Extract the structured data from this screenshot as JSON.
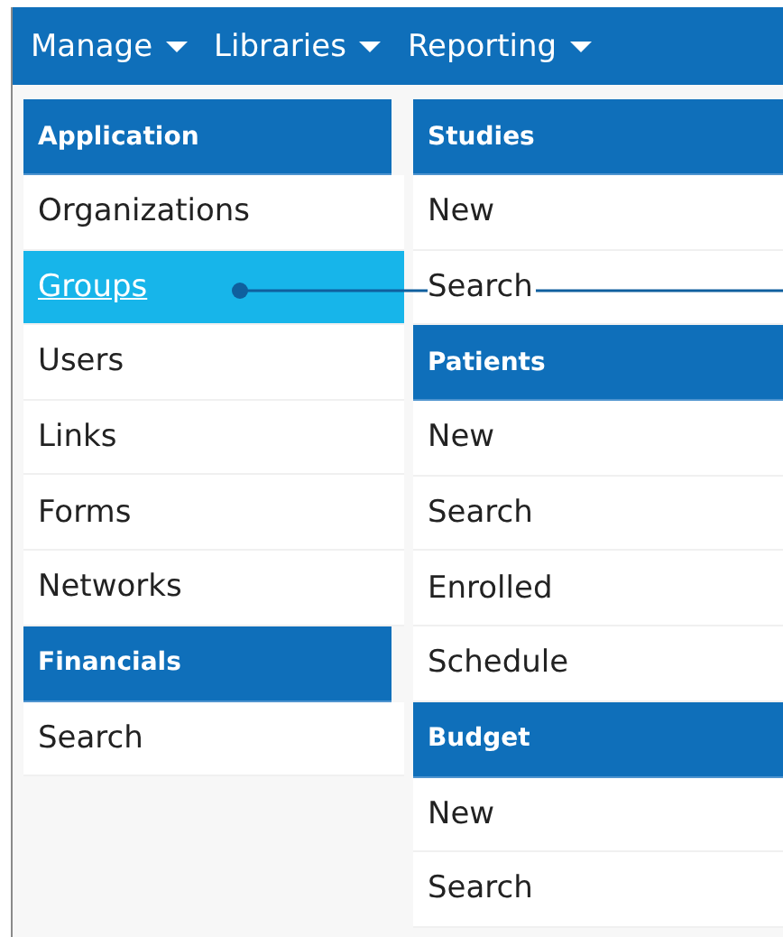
{
  "nav": [
    {
      "label": "Manage"
    },
    {
      "label": "Libraries"
    },
    {
      "label": "Reporting"
    }
  ],
  "columns": [
    {
      "sections": [
        {
          "title": "Application",
          "items": [
            {
              "label": "Organizations",
              "selected": false
            },
            {
              "label": "Groups",
              "selected": true
            },
            {
              "label": "Users",
              "selected": false
            },
            {
              "label": "Links",
              "selected": false
            },
            {
              "label": "Forms",
              "selected": false
            },
            {
              "label": "Networks",
              "selected": false
            }
          ]
        },
        {
          "title": "Financials",
          "items": [
            {
              "label": "Search",
              "selected": false
            }
          ]
        }
      ]
    },
    {
      "sections": [
        {
          "title": "Studies",
          "items": [
            {
              "label": "New",
              "selected": false
            },
            {
              "label": "Search",
              "selected": false
            }
          ]
        },
        {
          "title": "Patients",
          "items": [
            {
              "label": "New",
              "selected": false
            },
            {
              "label": "Search",
              "selected": false
            },
            {
              "label": "Enrolled",
              "selected": false
            },
            {
              "label": "Schedule",
              "selected": false
            }
          ]
        },
        {
          "title": "Budget",
          "items": [
            {
              "label": "New",
              "selected": false
            },
            {
              "label": "Search",
              "selected": false
            }
          ]
        }
      ]
    }
  ]
}
